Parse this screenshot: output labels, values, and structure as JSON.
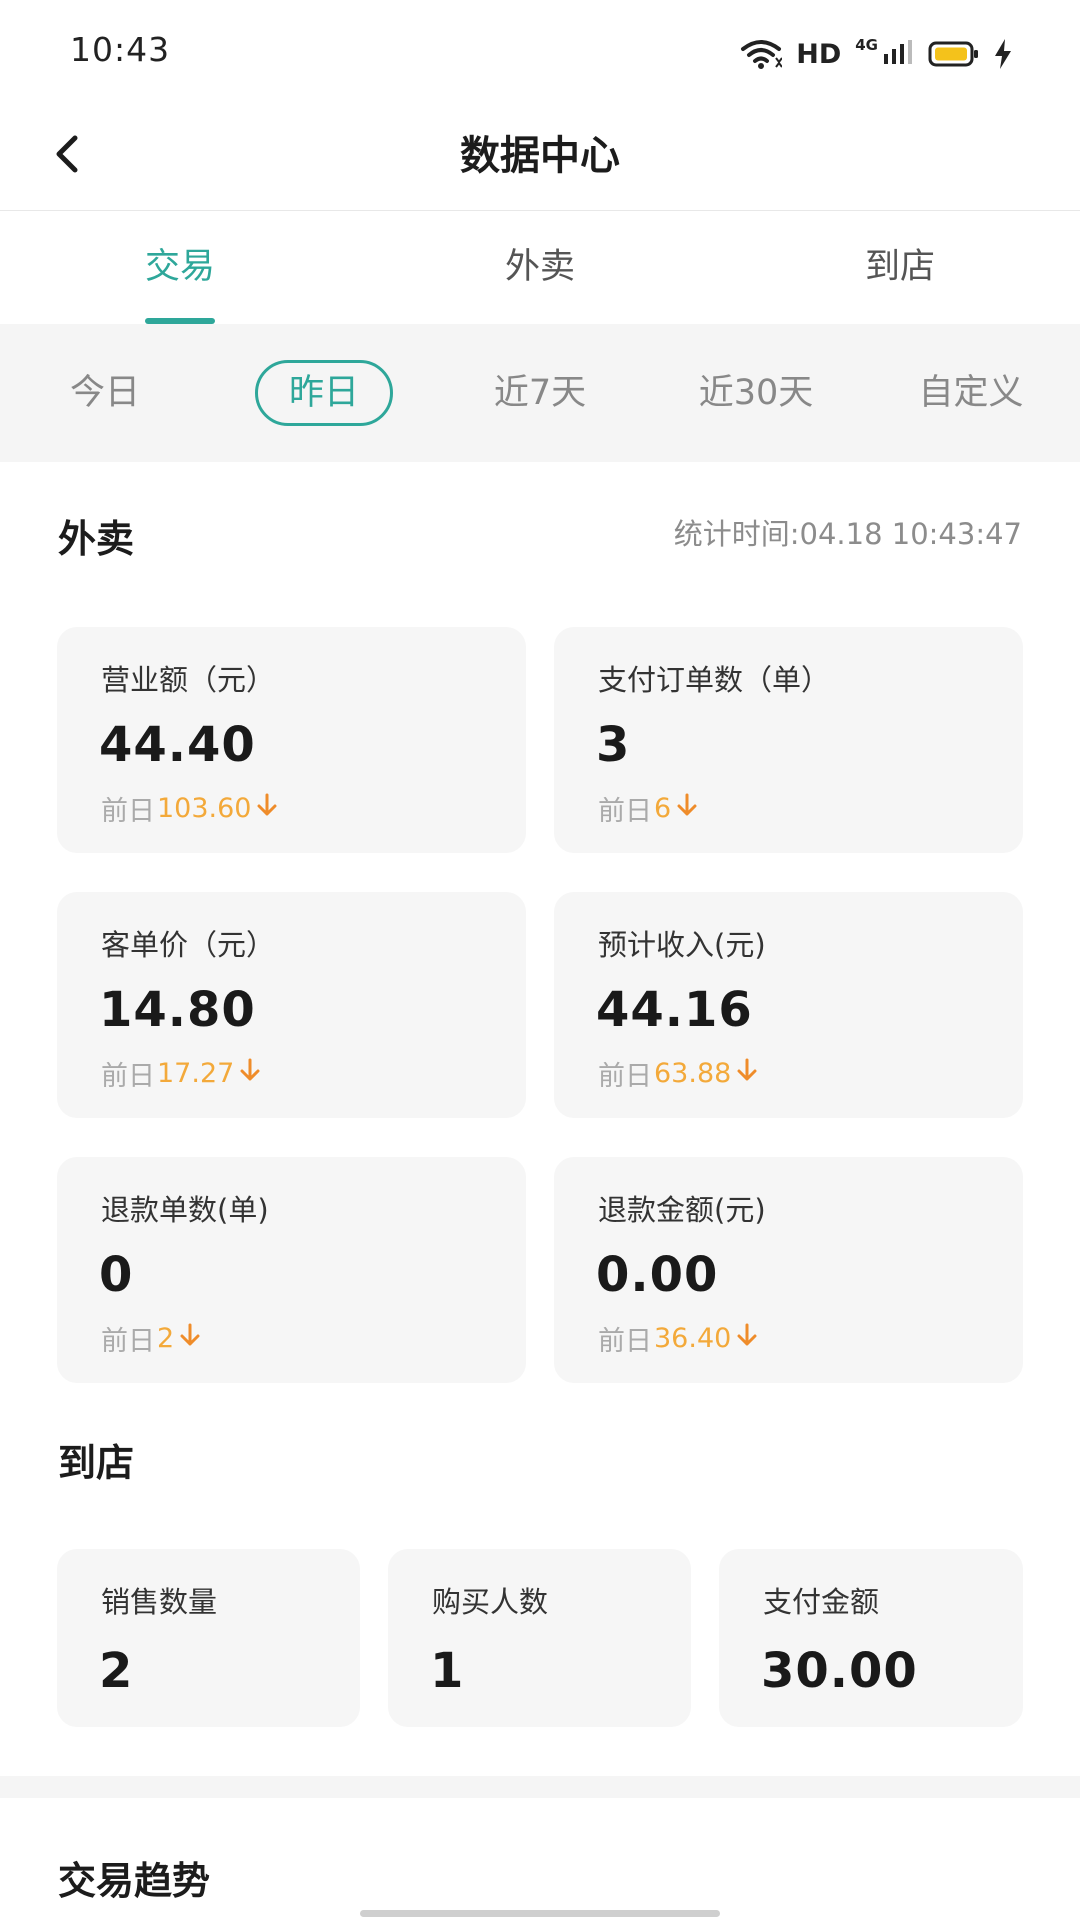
{
  "status_bar": {
    "time": "10:43",
    "hd": "HD",
    "network": "4G"
  },
  "nav": {
    "title": "数据中心"
  },
  "main_tabs": [
    {
      "label": "交易",
      "active": true
    },
    {
      "label": "外卖",
      "active": false
    },
    {
      "label": "到店",
      "active": false
    }
  ],
  "period_tabs": [
    {
      "label": "今日",
      "active": false
    },
    {
      "label": "昨日",
      "active": true
    },
    {
      "label": "近7天",
      "active": false
    },
    {
      "label": "近30天",
      "active": false
    },
    {
      "label": "自定义",
      "active": false
    }
  ],
  "takeout": {
    "title": "外卖",
    "stat_time": "统计时间:04.18 10:43:47",
    "cards": [
      {
        "label": "营业额（元）",
        "value": "44.40",
        "prev_prefix": "前日",
        "prev_value": "103.60"
      },
      {
        "label": "支付订单数（单）",
        "value": "3",
        "prev_prefix": "前日",
        "prev_value": "6"
      },
      {
        "label": "客单价（元）",
        "value": "14.80",
        "prev_prefix": "前日",
        "prev_value": "17.27"
      },
      {
        "label": "预计收入(元)",
        "value": "44.16",
        "prev_prefix": "前日",
        "prev_value": "63.88"
      },
      {
        "label": "退款单数(单)",
        "value": "0",
        "prev_prefix": "前日",
        "prev_value": "2"
      },
      {
        "label": "退款金额(元)",
        "value": "0.00",
        "prev_prefix": "前日",
        "prev_value": "36.40"
      }
    ]
  },
  "in_store": {
    "title": "到店",
    "cards": [
      {
        "label": "销售数量",
        "value": "2"
      },
      {
        "label": "购买人数",
        "value": "1"
      },
      {
        "label": "支付金额",
        "value": "30.00"
      }
    ]
  },
  "trend": {
    "title": "交易趋势"
  },
  "colors": {
    "accent": "#2ea79a",
    "prev_value": "#f3a93a",
    "arrow": "#ef8c2a",
    "card_bg": "#f6f6f6"
  }
}
